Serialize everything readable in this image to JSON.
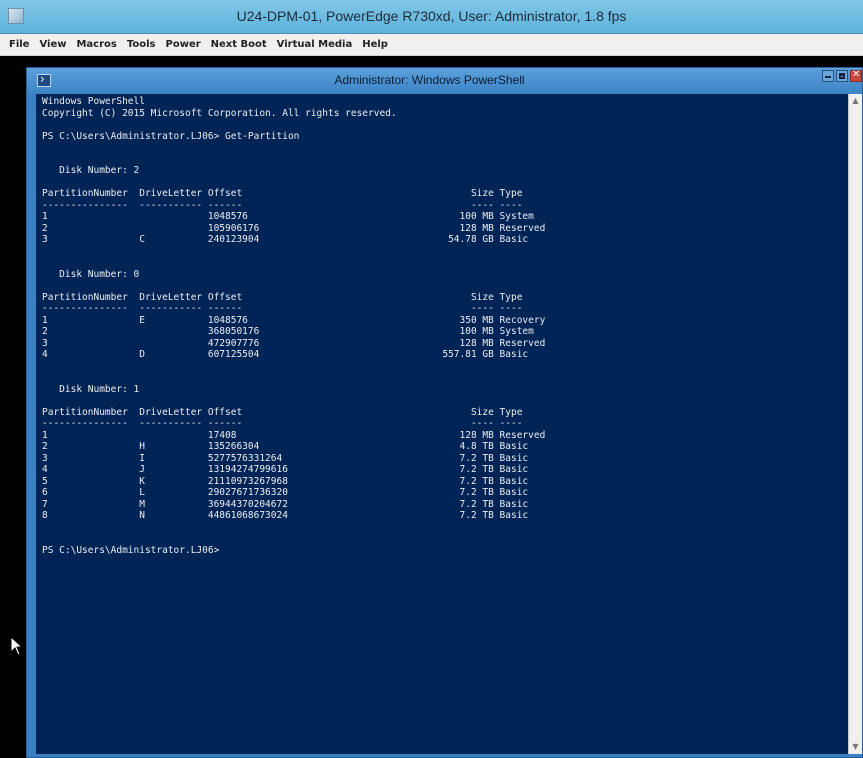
{
  "kvm": {
    "title": "U24-DPM-01, PowerEdge R730xd, User: Administrator, 1.8 fps",
    "menu": [
      "File",
      "View",
      "Macros",
      "Tools",
      "Power",
      "Next Boot",
      "Virtual Media",
      "Help"
    ]
  },
  "powershell": {
    "title": "Administrator: Windows PowerShell",
    "lines": [
      "Windows PowerShell",
      "Copyright (C) 2015 Microsoft Corporation. All rights reserved.",
      "",
      "PS C:\\Users\\Administrator.LJ06> Get-Partition",
      "",
      "",
      "   Disk Number: 2",
      "",
      "PartitionNumber  DriveLetter Offset                                        Size Type",
      "---------------  ----------- ------                                        ---- ----",
      "1                            1048576                                     100 MB System",
      "2                            105906176                                   128 MB Reserved",
      "3                C           240123904                                 54.78 GB Basic",
      "",
      "",
      "   Disk Number: 0",
      "",
      "PartitionNumber  DriveLetter Offset                                        Size Type",
      "---------------  ----------- ------                                        ---- ----",
      "1                E           1048576                                     350 MB Recovery",
      "2                            368050176                                   100 MB System",
      "3                            472907776                                   128 MB Reserved",
      "4                D           607125504                                557.81 GB Basic",
      "",
      "",
      "   Disk Number: 1",
      "",
      "PartitionNumber  DriveLetter Offset                                        Size Type",
      "---------------  ----------- ------                                        ---- ----",
      "1                            17408                                       128 MB Reserved",
      "2                H           135266304                                   4.8 TB Basic",
      "3                I           5277576331264                               7.2 TB Basic",
      "4                J           13194274799616                              7.2 TB Basic",
      "5                K           21110973267968                              7.2 TB Basic",
      "6                L           29027671736320                              7.2 TB Basic",
      "7                M           36944370204672                              7.2 TB Basic",
      "8                N           44861068673024                              7.2 TB Basic",
      "",
      "",
      "PS C:\\Users\\Administrator.LJ06>"
    ]
  },
  "icons": {
    "kvm_app": "java-app-icon",
    "ps_app": "powershell-icon",
    "minimize": "minimize-icon",
    "maximize": "maximize-icon",
    "close": "close-icon",
    "scroll_up": "scroll-up-icon",
    "scroll_down": "scroll-down-icon",
    "cursor": "mouse-cursor-icon"
  },
  "colors": {
    "console_bg": "#012456",
    "console_fg": "#eeedf0",
    "ps_frame": "#3b7fc4",
    "kvm_titlebar": "#6fbce2"
  }
}
